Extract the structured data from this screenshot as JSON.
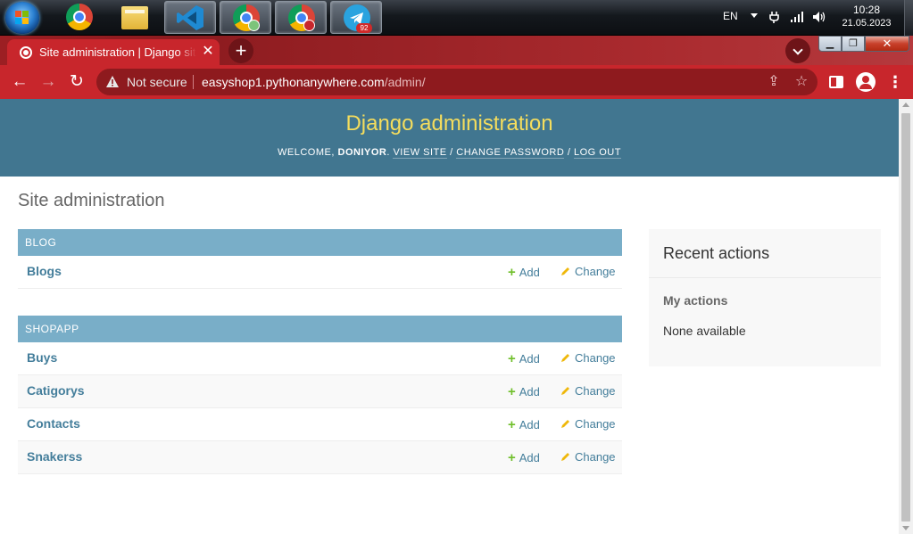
{
  "taskbar": {
    "language": "EN",
    "time": "10:28",
    "date": "21.05.2023",
    "telegram_badge": "92",
    "apps": [
      "start-button",
      "chrome-icon",
      "file-explorer-icon",
      "vscode-icon",
      "chrome-profile-icon",
      "chrome-profile-active-icon",
      "telegram-icon"
    ]
  },
  "browser": {
    "tab_title": "Site administration | Django site admin",
    "security_label": "Not secure",
    "url_host": "easyshop1.pythonanywhere.com",
    "url_path": "/admin/",
    "accent_color": "#c8262c"
  },
  "header": {
    "site_name": "Django administration",
    "welcome": "WELCOME,",
    "username": "DONIYOR",
    "view_site": "VIEW SITE",
    "change_password": "CHANGE PASSWORD",
    "log_out": "LOG OUT",
    "sep": "/",
    "period": "."
  },
  "page": {
    "title": "Site administration"
  },
  "apps": [
    {
      "caption": "BLOG",
      "models": [
        {
          "name": "Blogs",
          "add": "Add",
          "change": "Change"
        }
      ]
    },
    {
      "caption": "SHOPAPP",
      "models": [
        {
          "name": "Buys",
          "add": "Add",
          "change": "Change"
        },
        {
          "name": "Catigorys",
          "add": "Add",
          "change": "Change"
        },
        {
          "name": "Contacts",
          "add": "Add",
          "change": "Change"
        },
        {
          "name": "Snakerss",
          "add": "Add",
          "change": "Change"
        }
      ]
    }
  ],
  "sidebar": {
    "title": "Recent actions",
    "my_actions": "My actions",
    "empty": "None available"
  }
}
